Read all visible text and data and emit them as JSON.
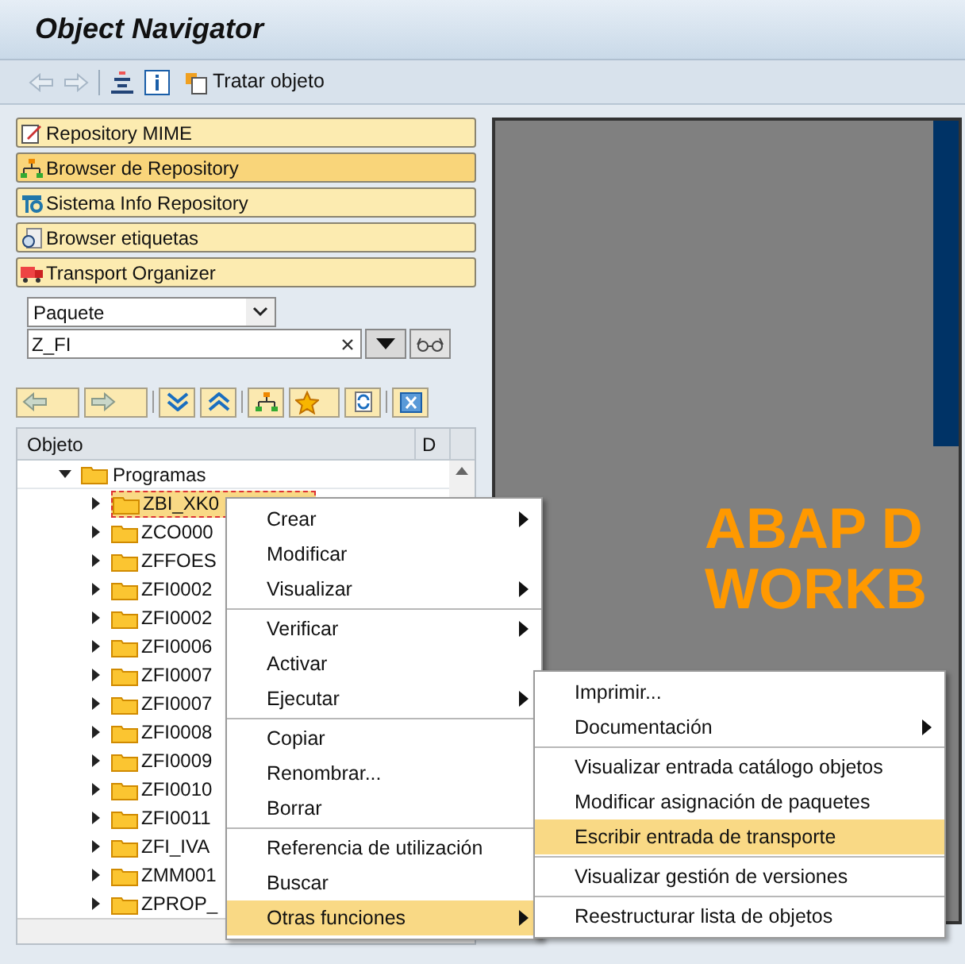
{
  "window": {
    "title": "Object Navigator"
  },
  "toolbar": {
    "edit_label": "Tratar objeto"
  },
  "nav_buttons": [
    {
      "label": "Repository MIME",
      "selected": false
    },
    {
      "label": "Browser de Repository",
      "selected": true
    },
    {
      "label": "Sistema Info Repository",
      "selected": false
    },
    {
      "label": "Browser etiquetas",
      "selected": false
    },
    {
      "label": "Transport Organizer",
      "selected": false
    }
  ],
  "object_type": {
    "value": "Paquete"
  },
  "object_name": {
    "value": "Z_FI"
  },
  "tree": {
    "columns": [
      "Objeto",
      "D"
    ],
    "root": {
      "label": "Programas",
      "expanded": true,
      "children": [
        {
          "label": "ZBI_XK0",
          "selected": true
        },
        {
          "label": "ZCO000",
          "selected": false
        },
        {
          "label": "ZFFOES",
          "selected": false
        },
        {
          "label": "ZFI0002",
          "selected": false
        },
        {
          "label": "ZFI0002",
          "selected": false
        },
        {
          "label": "ZFI0006",
          "selected": false
        },
        {
          "label": "ZFI0007",
          "selected": false
        },
        {
          "label": "ZFI0007",
          "selected": false
        },
        {
          "label": "ZFI0008",
          "selected": false
        },
        {
          "label": "ZFI0009",
          "selected": false
        },
        {
          "label": "ZFI0010",
          "selected": false
        },
        {
          "label": "ZFI0011",
          "selected": false
        },
        {
          "label": "ZFI_IVA",
          "selected": false
        },
        {
          "label": "ZMM001",
          "selected": false
        },
        {
          "label": "ZPROP_",
          "selected": false
        }
      ]
    }
  },
  "splash": {
    "lines": [
      "ABAP D",
      "WORKB"
    ]
  },
  "context_menu": {
    "groups": [
      [
        {
          "label": "Crear",
          "has_submenu": true,
          "selected": false
        },
        {
          "label": "Modificar",
          "has_submenu": false,
          "selected": false
        },
        {
          "label": "Visualizar",
          "has_submenu": true,
          "selected": false
        }
      ],
      [
        {
          "label": "Verificar",
          "has_submenu": true,
          "selected": false
        },
        {
          "label": "Activar",
          "has_submenu": false,
          "selected": false
        },
        {
          "label": "Ejecutar",
          "has_submenu": true,
          "selected": false
        }
      ],
      [
        {
          "label": "Copiar",
          "has_submenu": false,
          "selected": false
        },
        {
          "label": "Renombrar...",
          "has_submenu": false,
          "selected": false
        },
        {
          "label": "Borrar",
          "has_submenu": false,
          "selected": false
        }
      ],
      [
        {
          "label": "Referencia de utilización",
          "has_submenu": false,
          "selected": false
        },
        {
          "label": "Buscar",
          "has_submenu": false,
          "selected": false
        },
        {
          "label": "Otras funciones",
          "has_submenu": true,
          "selected": true
        }
      ]
    ]
  },
  "submenu": {
    "groups": [
      [
        {
          "label": "Imprimir...",
          "has_submenu": false,
          "selected": false
        },
        {
          "label": "Documentación",
          "has_submenu": true,
          "selected": false
        }
      ],
      [
        {
          "label": "Visualizar entrada catálogo objetos",
          "has_submenu": false,
          "selected": false
        },
        {
          "label": "Modificar asignación de paquetes",
          "has_submenu": false,
          "selected": false
        },
        {
          "label": "Escribir entrada de transporte",
          "has_submenu": false,
          "selected": true
        }
      ],
      [
        {
          "label": "Visualizar gestión de versiones",
          "has_submenu": false,
          "selected": false
        }
      ],
      [
        {
          "label": "Reestructurar lista de objetos",
          "has_submenu": false,
          "selected": false
        }
      ]
    ]
  }
}
